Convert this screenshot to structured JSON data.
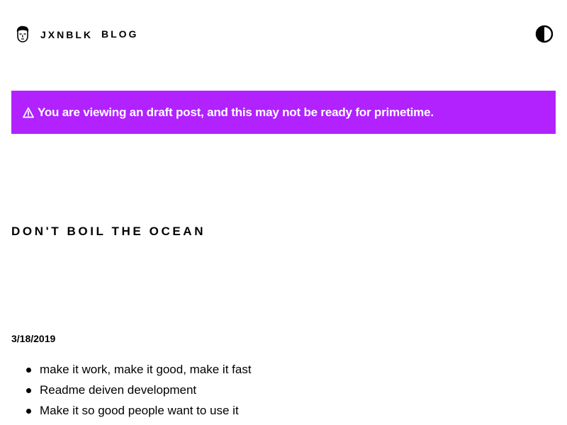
{
  "header": {
    "brand": "JXNBLK",
    "nav_blog": "BLOG",
    "avatar_icon": "face-avatar-icon",
    "theme_toggle_icon": "half-circle-contrast-icon"
  },
  "banner": {
    "icon": "warning-triangle-icon",
    "text": "You are viewing an draft post, and this may not be ready for primetime.",
    "background": "#b122ff"
  },
  "post": {
    "title": "DON'T BOIL THE OCEAN",
    "date": "3/18/2019",
    "items": [
      "make it work, make it good, make it fast",
      "Readme deiven development",
      "Make it so good people want to use it"
    ]
  }
}
